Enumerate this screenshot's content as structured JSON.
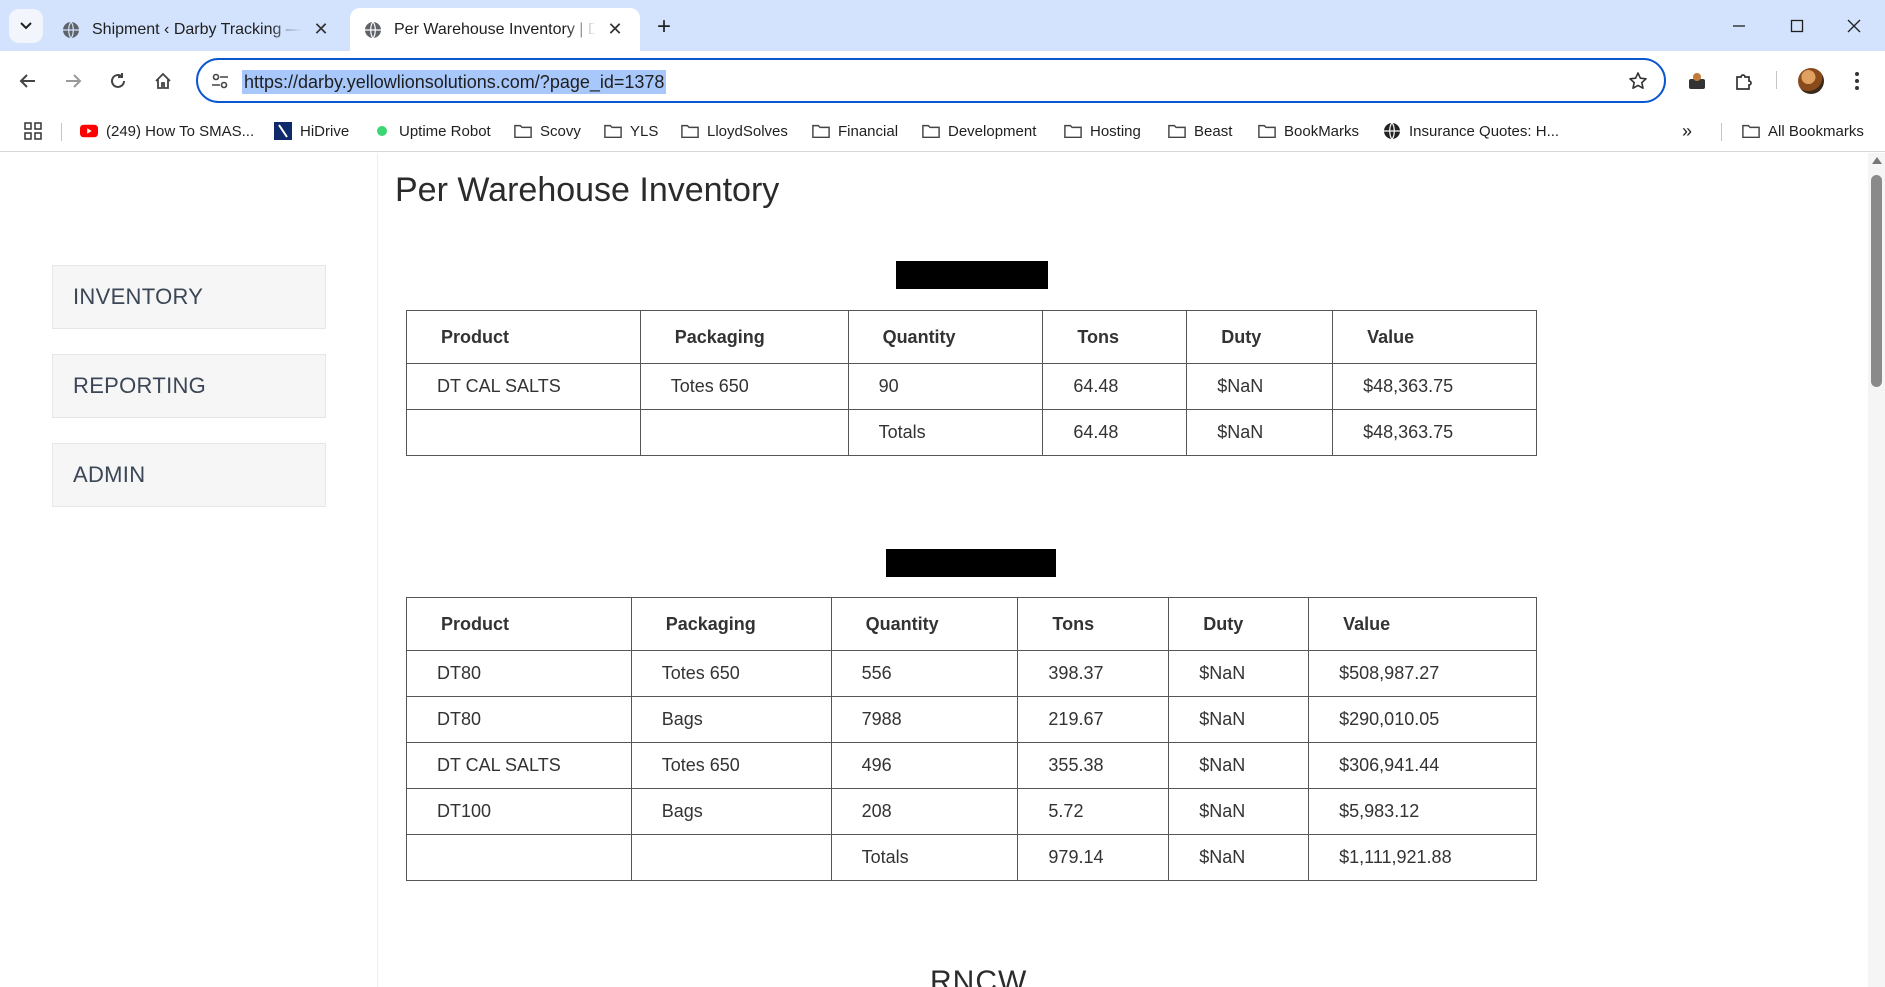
{
  "browser": {
    "tabs": [
      {
        "title": "Shipment ‹ Darby Tracking — WordPress",
        "active": false
      },
      {
        "title": "Per Warehouse Inventory | Darby Tracking",
        "active": true
      }
    ],
    "url": "https://darby.yellowlionsolutions.com/?page_id=1378",
    "bookmarks": [
      {
        "label": "(249) How To SMAS...",
        "icon": "youtube-icon"
      },
      {
        "label": "HiDrive",
        "icon": "hidrive-icon"
      },
      {
        "label": "Uptime Robot",
        "icon": "uptime-dot-icon"
      },
      {
        "label": "Scovy",
        "icon": "folder-icon"
      },
      {
        "label": "YLS",
        "icon": "folder-icon"
      },
      {
        "label": "LloydSolves",
        "icon": "folder-icon"
      },
      {
        "label": "Financial",
        "icon": "folder-icon"
      },
      {
        "label": "Development",
        "icon": "folder-icon"
      },
      {
        "label": "Hosting",
        "icon": "folder-icon"
      },
      {
        "label": "Beast",
        "icon": "folder-icon"
      },
      {
        "label": "BookMarks",
        "icon": "folder-icon"
      },
      {
        "label": "Insurance Quotes: H...",
        "icon": "globe-icon"
      }
    ],
    "all_bookmarks": "All Bookmarks",
    "colors": {
      "tabbar": "#d3e3fd",
      "omnibox_border": "#0b57d0",
      "url_highlight": "#a8c7fa"
    }
  },
  "sidebar": {
    "items": [
      {
        "label": "INVENTORY"
      },
      {
        "label": "REPORTING"
      },
      {
        "label": "ADMIN"
      }
    ]
  },
  "page": {
    "title": "Per Warehouse Inventory",
    "partial_heading": "RNCW"
  },
  "tables": [
    {
      "headers": [
        "Product",
        "Packaging",
        "Quantity",
        "Tons",
        "Duty",
        "Value"
      ],
      "rows": [
        [
          "DT CAL SALTS",
          "Totes 650",
          "90",
          "64.48",
          "$NaN",
          "$48,363.75"
        ],
        [
          "",
          "",
          "Totals",
          "64.48",
          "$NaN",
          "$48,363.75"
        ]
      ]
    },
    {
      "headers": [
        "Product",
        "Packaging",
        "Quantity",
        "Tons",
        "Duty",
        "Value"
      ],
      "rows": [
        [
          "DT80",
          "Totes 650",
          "556",
          "398.37",
          "$NaN",
          "$508,987.27"
        ],
        [
          "DT80",
          "Bags",
          "7988",
          "219.67",
          "$NaN",
          "$290,010.05"
        ],
        [
          "DT CAL SALTS",
          "Totes 650",
          "496",
          "355.38",
          "$NaN",
          "$306,941.44"
        ],
        [
          "DT100",
          "Bags",
          "208",
          "5.72",
          "$NaN",
          "$5,983.12"
        ],
        [
          "",
          "",
          "Totals",
          "979.14",
          "$NaN",
          "$1,111,921.88"
        ]
      ]
    }
  ]
}
